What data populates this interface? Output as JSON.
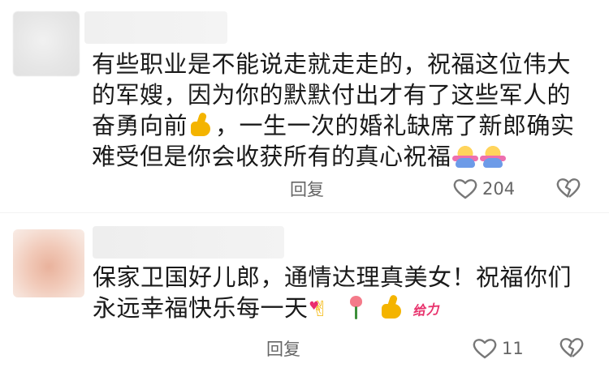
{
  "comments": [
    {
      "lines": [
        "有些职业是不能说走就走走的，祝福这位伟大",
        "的军嫂，因为你的默默付出才有了这些军人的",
        "奋勇向前",
        "，一生一次的婚礼缺席了新郎确实",
        "难受但是你会收获所有的真心祝福"
      ],
      "reply_label": "回复",
      "like_count": "204",
      "emojis": [
        "thumbs-up-emoji",
        "hugging-face-emoji",
        "hugging-face-emoji"
      ]
    },
    {
      "lines": [
        "保家卫国好儿郎，通情达理真美女！祝福你们",
        "永远幸福快乐每一天"
      ],
      "reply_label": "回复",
      "like_count": "11",
      "sticker": "给力",
      "emojis": [
        "heart-fingers-emoji",
        "rose-emoji",
        "thumbs-up-emoji"
      ]
    }
  ],
  "colors": {
    "text": "#1a1a1a",
    "meta": "#666666",
    "sticker": "#e8336d"
  }
}
